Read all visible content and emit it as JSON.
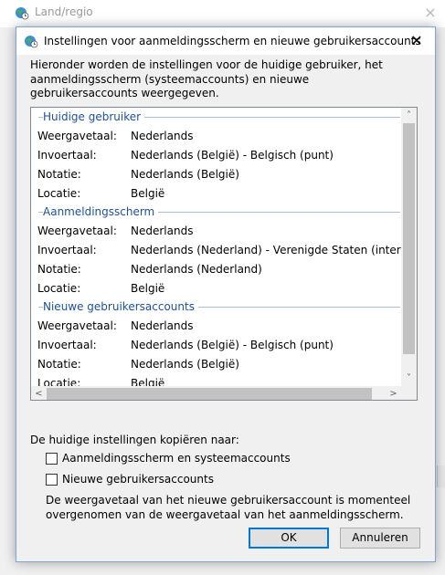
{
  "parent_window": {
    "title": "Land/regio",
    "close_glyph": "×"
  },
  "dialog": {
    "title": "Instellingen voor aanmeldingsscherm en nieuwe gebruikersaccounts",
    "close_glyph": "✕",
    "intro_text": "Hieronder worden de instellingen voor de huidige gebruiker, het aanmeldingsscherm (systeemaccounts) en nieuwe gebruikersaccounts weergegeven.",
    "groups": [
      {
        "header": "Huidige gebruiker",
        "rows": [
          {
            "label": "Weergavetaal:",
            "value": "Nederlands"
          },
          {
            "label": "Invoertaal:",
            "value": "Nederlands (België) - Belgisch (punt)"
          },
          {
            "label": "Notatie:",
            "value": "Nederlands (België)"
          },
          {
            "label": "Locatie:",
            "value": "België"
          }
        ]
      },
      {
        "header": "Aanmeldingsscherm",
        "rows": [
          {
            "label": "Weergavetaal:",
            "value": "Nederlands"
          },
          {
            "label": "Invoertaal:",
            "value": "Nederlands (Nederland) - Verenigde Staten (international)"
          },
          {
            "label": "Notatie:",
            "value": "Nederlands (Nederland)"
          },
          {
            "label": "Locatie:",
            "value": "België"
          }
        ]
      },
      {
        "header": "Nieuwe gebruikersaccounts",
        "rows": [
          {
            "label": "Weergavetaal:",
            "value": "Nederlands"
          },
          {
            "label": "Invoertaal:",
            "value": "Nederlands (België) - Belgisch (punt)"
          },
          {
            "label": "Notatie:",
            "value": "Nederlands (België)"
          },
          {
            "label": "Locatie:",
            "value": "België"
          }
        ]
      }
    ],
    "copy_label": "De huidige instellingen kopiëren naar:",
    "checkboxes": [
      {
        "label": "Aanmeldingsscherm en systeemaccounts",
        "checked": false
      },
      {
        "label": "Nieuwe gebruikersaccounts",
        "checked": false
      }
    ],
    "note": "De weergavetaal van het nieuwe gebruikersaccount is momenteel overgenomen van de weergavetaal van het aanmeldingsscherm.",
    "ok_label": "OK",
    "cancel_label": "Annuleren"
  },
  "icons": {
    "window_icon": "globe-clock-icon",
    "scroll_up": "chevron-up-icon",
    "scroll_down": "chevron-down-icon",
    "scroll_left": "chevron-left-icon",
    "scroll_right": "chevron-right-icon"
  },
  "colors": {
    "group_header": "#1e50a0",
    "accent_border": "#0078d7",
    "dialog_border": "#7aa6d8"
  }
}
